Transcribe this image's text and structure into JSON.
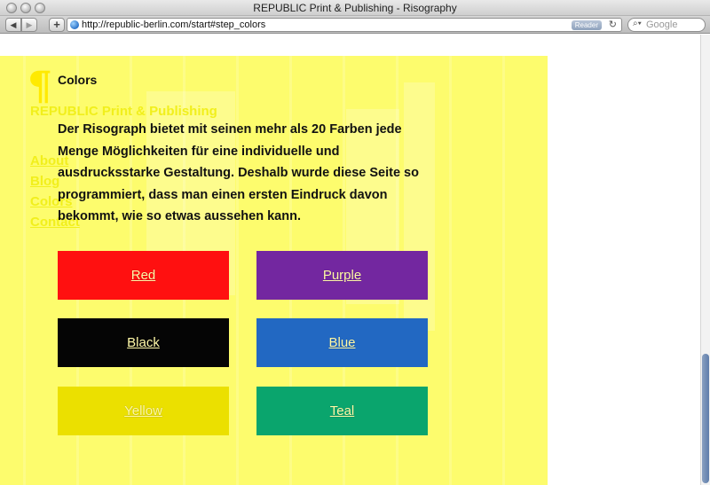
{
  "window": {
    "title": "REPUBLIC Print & Publishing - Risography"
  },
  "toolbar": {
    "back_icon": "back-arrow-icon",
    "forward_icon": "forward-arrow-icon",
    "add_label": "+",
    "url": "http://republic-berlin.com/start#step_colors",
    "reader_label": "Reader",
    "search_placeholder": "Google"
  },
  "site": {
    "title": "REPUBLIC Print & Publishing",
    "nav": [
      "About",
      "Blog",
      "Colors",
      "Contact"
    ]
  },
  "page": {
    "heading": "Colors",
    "intro": "Der Risograph bietet mit seinen mehr als 20 Farben jede Menge Möglichkeiten für eine individuelle und ausdrucksstarke Gestaltung. Deshalb wurde diese Seite so programmiert, dass man einen ersten Eindruck davon bekommt, wie so etwas aussehen kann."
  },
  "swatches": [
    {
      "label": "Red",
      "color": "#ff1010"
    },
    {
      "label": "Purple",
      "color": "#7327a0"
    },
    {
      "label": "Black",
      "color": "#050505"
    },
    {
      "label": "Blue",
      "color": "#2268c2"
    },
    {
      "label": "Yellow",
      "color": "#ebe000"
    },
    {
      "label": "Teal",
      "color": "#0aa56d"
    }
  ],
  "colors": {
    "background": "#fdfc6d",
    "link": "#f1ef1c"
  }
}
